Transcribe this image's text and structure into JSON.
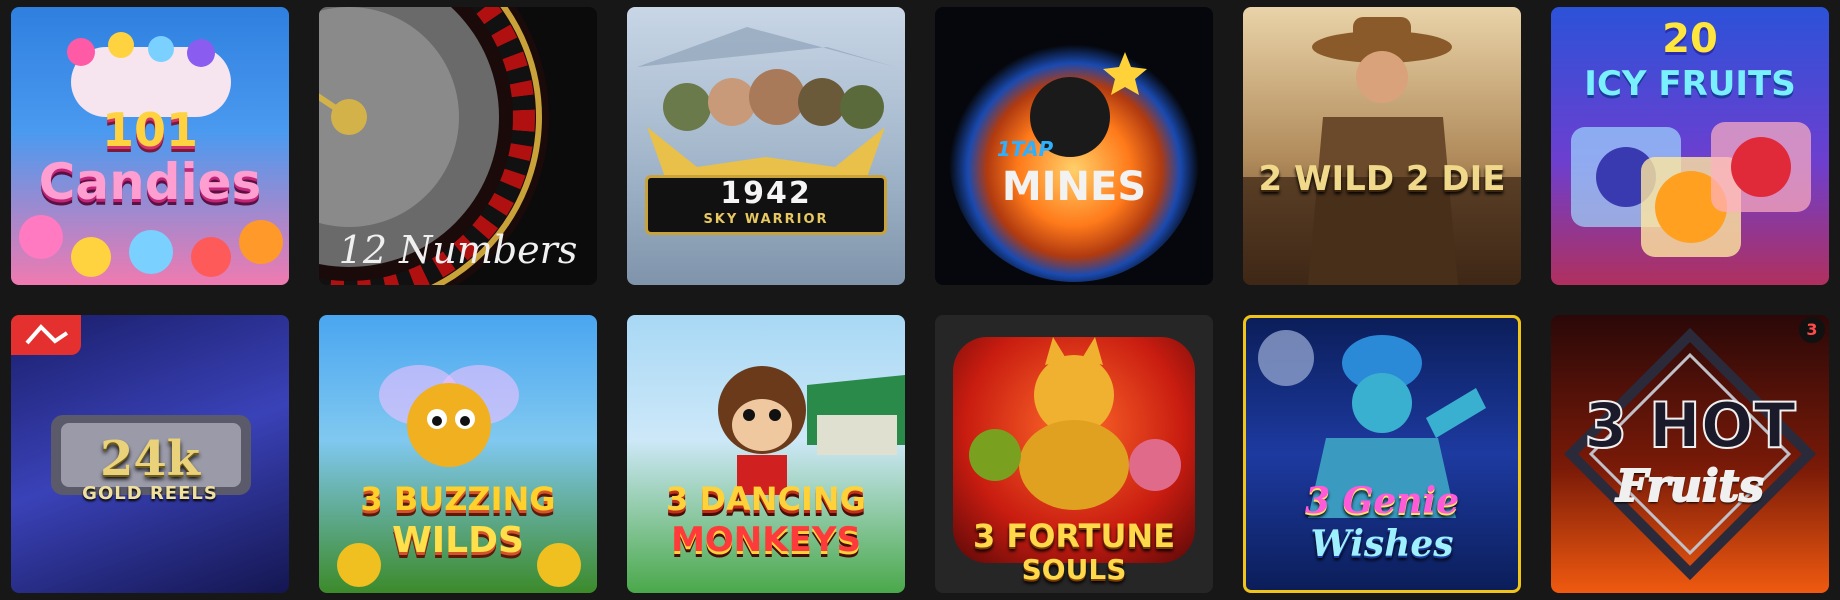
{
  "games": [
    {
      "title": "101",
      "title2": "Candies"
    },
    {
      "title": "12 Numbers"
    },
    {
      "title": "1942",
      "subtitle": "SKY WARRIOR"
    },
    {
      "title": "MINES",
      "subtitle": "1TAP"
    },
    {
      "title": "2 WILD 2 DIE"
    },
    {
      "title": "20",
      "title2": "ICY FRUITS"
    },
    {
      "title": "24k",
      "subtitle": "GOLD REELS"
    },
    {
      "title": "3 BUZZING",
      "title2": "WILDS"
    },
    {
      "title": "3 DANCING",
      "title2": "MONKEYS"
    },
    {
      "title": "3 FORTUNE",
      "subtitle": "SOULS"
    },
    {
      "title": "3 Genie",
      "title2": "Wishes"
    },
    {
      "title": "3 HOT",
      "title2": "Fruits"
    }
  ],
  "badges": {
    "row2_col1_tag": "provider-logo-icon",
    "row2_col6_corner": "3"
  },
  "colors": {
    "page_background": "#171717",
    "genie_border": "#f0c419"
  }
}
